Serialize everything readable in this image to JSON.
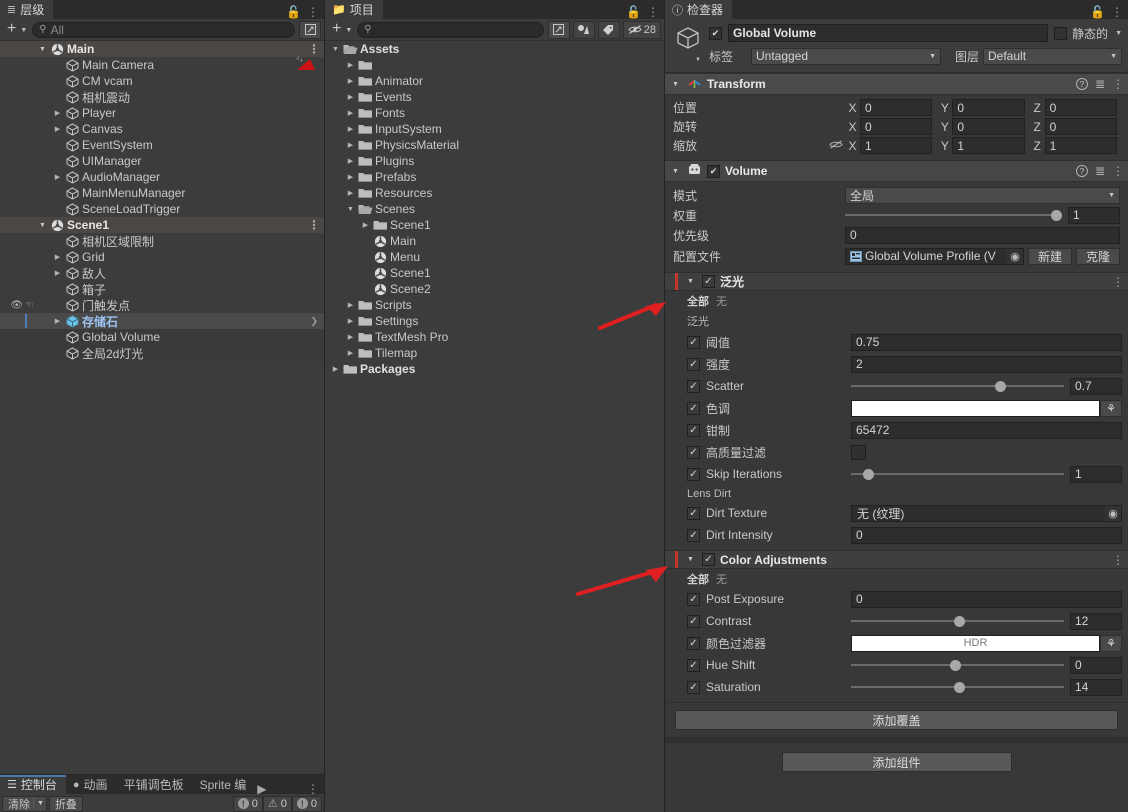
{
  "hierarchy": {
    "tab_label": "层级",
    "tab_icon": "hierarchy-icon",
    "search_placeholder": "All",
    "items": [
      {
        "label": "Main",
        "depth": 0,
        "type": "scene",
        "expanded": true,
        "kebab": true
      },
      {
        "label": "Main Camera",
        "depth": 1,
        "type": "go",
        "badge": "camera-preview-icon"
      },
      {
        "label": "CM vcam",
        "depth": 1,
        "type": "go"
      },
      {
        "label": "相机震动",
        "depth": 1,
        "type": "go"
      },
      {
        "label": "Player",
        "depth": 1,
        "type": "go",
        "collapsed": true
      },
      {
        "label": "Canvas",
        "depth": 1,
        "type": "go",
        "collapsed": true
      },
      {
        "label": "EventSystem",
        "depth": 1,
        "type": "go"
      },
      {
        "label": "UIManager",
        "depth": 1,
        "type": "go"
      },
      {
        "label": "AudioManager",
        "depth": 1,
        "type": "go",
        "collapsed": true
      },
      {
        "label": "MainMenuManager",
        "depth": 1,
        "type": "go"
      },
      {
        "label": "SceneLoadTrigger",
        "depth": 1,
        "type": "go"
      },
      {
        "label": "Scene1",
        "depth": 0,
        "type": "scene",
        "expanded": true,
        "kebab": true
      },
      {
        "label": "相机区域限制",
        "depth": 1,
        "type": "go"
      },
      {
        "label": "Grid",
        "depth": 1,
        "type": "go",
        "collapsed": true
      },
      {
        "label": "敌人",
        "depth": 1,
        "type": "go",
        "collapsed": true
      },
      {
        "label": "箱子",
        "depth": 1,
        "type": "go"
      },
      {
        "label": "门触发点",
        "depth": 1,
        "type": "go",
        "visibility": true
      },
      {
        "label": "存储石",
        "depth": 1,
        "type": "prefab",
        "collapsed": true,
        "selected": true
      },
      {
        "label": "Global Volume",
        "depth": 1,
        "type": "go"
      },
      {
        "label": "全局2d灯光",
        "depth": 1,
        "type": "go"
      }
    ]
  },
  "console": {
    "tabs": [
      {
        "label": "控制台",
        "icon": "console-icon",
        "active": true
      },
      {
        "label": "动画",
        "icon": "animation-icon",
        "active": false
      },
      {
        "label": "平铺调色板",
        "icon": "",
        "active": false
      },
      {
        "label": "Sprite 编",
        "icon": "",
        "active": false
      }
    ],
    "clear_label": "清除",
    "collapse_label": "折叠",
    "log_count": "0",
    "warn_count": "0",
    "error_count": "0"
  },
  "project": {
    "tab_label": "项目",
    "tab_icon": "folder-icon",
    "search_placeholder": "",
    "hidden_count": "28",
    "items": [
      {
        "label": "Assets",
        "depth": 0,
        "type": "folder-open",
        "expanded": true,
        "bold": true
      },
      {
        "label": "",
        "depth": 1,
        "type": "folder",
        "collapsed": true
      },
      {
        "label": "Animator",
        "depth": 1,
        "type": "folder",
        "collapsed": true
      },
      {
        "label": "Events",
        "depth": 1,
        "type": "folder",
        "collapsed": true
      },
      {
        "label": "Fonts",
        "depth": 1,
        "type": "folder",
        "collapsed": true
      },
      {
        "label": "InputSystem",
        "depth": 1,
        "type": "folder",
        "collapsed": true
      },
      {
        "label": "PhysicsMaterial",
        "depth": 1,
        "type": "folder",
        "collapsed": true
      },
      {
        "label": "Plugins",
        "depth": 1,
        "type": "folder",
        "collapsed": true
      },
      {
        "label": "Prefabs",
        "depth": 1,
        "type": "folder",
        "collapsed": true
      },
      {
        "label": "Resources",
        "depth": 1,
        "type": "folder",
        "collapsed": true
      },
      {
        "label": "Scenes",
        "depth": 1,
        "type": "folder-open",
        "expanded": true
      },
      {
        "label": "Scene1",
        "depth": 2,
        "type": "folder",
        "collapsed": true
      },
      {
        "label": "Main",
        "depth": 2,
        "type": "scene"
      },
      {
        "label": "Menu",
        "depth": 2,
        "type": "scene"
      },
      {
        "label": "Scene1",
        "depth": 2,
        "type": "scene"
      },
      {
        "label": "Scene2",
        "depth": 2,
        "type": "scene"
      },
      {
        "label": "Scripts",
        "depth": 1,
        "type": "folder",
        "collapsed": true
      },
      {
        "label": "Settings",
        "depth": 1,
        "type": "folder",
        "collapsed": true
      },
      {
        "label": "TextMesh Pro",
        "depth": 1,
        "type": "folder",
        "collapsed": true
      },
      {
        "label": "Tilemap",
        "depth": 1,
        "type": "folder",
        "collapsed": true
      },
      {
        "label": "Packages",
        "depth": 0,
        "type": "folder",
        "collapsed": true,
        "bold": true
      }
    ]
  },
  "inspector": {
    "tab_label": "检查器",
    "tab_icon": "info-icon",
    "object": {
      "enabled": true,
      "name": "Global Volume",
      "static_label": "静态的",
      "static_checked": false,
      "tag_label": "标签",
      "tag_value": "Untagged",
      "layer_label": "图层",
      "layer_value": "Default"
    },
    "transform": {
      "title": "Transform",
      "position_label": "位置",
      "position": {
        "x": "0",
        "y": "0",
        "z": "0"
      },
      "rotation_label": "旋转",
      "rotation": {
        "x": "0",
        "y": "0",
        "z": "0"
      },
      "scale_label": "缩放",
      "scale": {
        "x": "1",
        "y": "1",
        "z": "1"
      },
      "axis_x": "X",
      "axis_y": "Y",
      "axis_z": "Z"
    },
    "volume": {
      "title": "Volume",
      "enabled": true,
      "mode_label": "模式",
      "mode_value": "全局",
      "weight_label": "权重",
      "weight_value": "1",
      "weight_pct": 100,
      "priority_label": "优先级",
      "priority_value": "0",
      "profile_label": "配置文件",
      "profile_value": "Global Volume Profile (V",
      "new_label": "新建",
      "clone_label": "克隆"
    },
    "overrides": [
      {
        "title": "泛光",
        "enabled": true,
        "all_label": "全部",
        "none_label": "无",
        "group_label": "泛光",
        "red_mark": true,
        "rows": [
          {
            "label": "阈值",
            "kind": "number",
            "value": "0.75"
          },
          {
            "label": "强度",
            "kind": "number",
            "value": "2"
          },
          {
            "label": "Scatter",
            "kind": "slider",
            "value": "0.7",
            "pct": 70
          },
          {
            "label": "色调",
            "kind": "color",
            "swatch": "#ffffff",
            "swatch_text": ""
          },
          {
            "label": "钳制",
            "kind": "number",
            "value": "65472"
          },
          {
            "label": "高质量过滤",
            "kind": "checkbox",
            "value": ""
          },
          {
            "label": "Skip Iterations",
            "kind": "slider",
            "value": "1",
            "pct": 8
          }
        ],
        "group2_label": "Lens Dirt",
        "rows2": [
          {
            "label": "Dirt Texture",
            "kind": "object",
            "value": "无 (纹理)"
          },
          {
            "label": "Dirt Intensity",
            "kind": "number",
            "value": "0"
          }
        ]
      },
      {
        "title": "Color Adjustments",
        "enabled": true,
        "all_label": "全部",
        "none_label": "无",
        "red_mark": true,
        "rows": [
          {
            "label": "Post Exposure",
            "kind": "number",
            "value": "0"
          },
          {
            "label": "Contrast",
            "kind": "slider",
            "value": "12",
            "pct": 51
          },
          {
            "label": "颜色过滤器",
            "kind": "color",
            "swatch": "#ffffff",
            "swatch_text": "HDR"
          },
          {
            "label": "Hue Shift",
            "kind": "slider",
            "value": "0",
            "pct": 49
          },
          {
            "label": "Saturation",
            "kind": "slider",
            "value": "14",
            "pct": 51
          }
        ]
      }
    ],
    "add_overlay_label": "添加覆盖",
    "add_component_label": "添加组件"
  },
  "colors": {
    "panel_bg": "#383838",
    "row_bg": "#3c3c3c",
    "header_bg": "#4b4b4b",
    "selection_blue": "#4f7bb8",
    "selected_text": "#9cc2ee",
    "annotation_red": "#e02020",
    "tab_accent": "#4a78a8"
  }
}
